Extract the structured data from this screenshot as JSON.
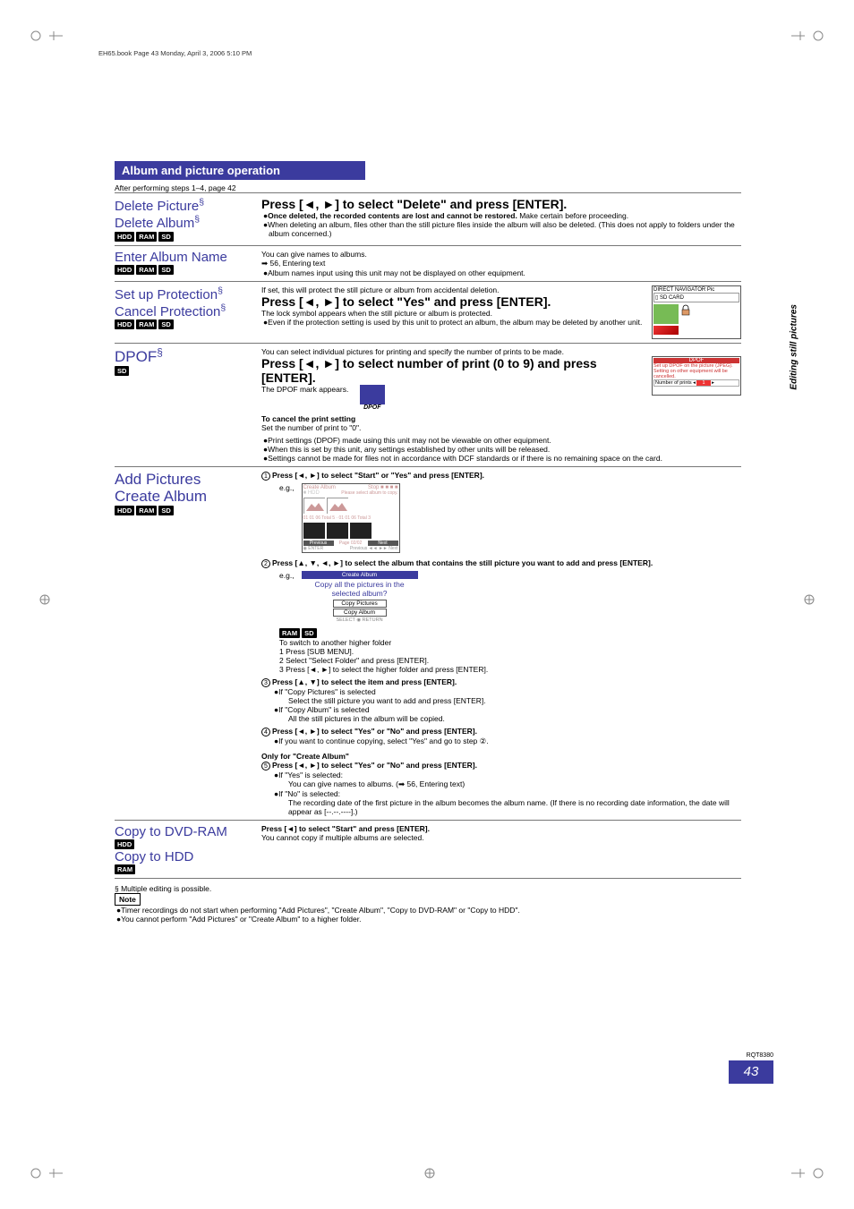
{
  "meta": {
    "header": "EH65.book  Page 43  Monday, April 3, 2006  5:10 PM"
  },
  "section": {
    "title": "Album and picture operation"
  },
  "intro": "After performing steps 1–4, page 42",
  "side": "Editing still pictures",
  "pagenum": "43",
  "rqt": "RQT8380",
  "badges": {
    "hdd": "HDD",
    "ram": "RAM",
    "sd": "SD"
  },
  "deletePic": {
    "t1": "Delete Picture",
    "t2": "Delete Album",
    "cmd": "Press [◄, ►] to select \"Delete\" and press [ENTER].",
    "b1a": "Once deleted, the recorded contents are lost and cannot be restored.",
    "b1b": " Make certain before proceeding.",
    "b2": "When deleting an album, files other than the still picture files inside the album will also be deleted. (This does not apply to folders under the album concerned.)"
  },
  "enter": {
    "t": "Enter Album Name",
    "l1": "You can give names to albums.",
    "l2": "➡ 56, Entering text",
    "l3": "Album names input using this unit may not be displayed on other equipment."
  },
  "protect": {
    "t1": "Set up Protection",
    "t2": "Cancel Protection",
    "l1": "If set, this will protect the still picture or album from accidental deletion.",
    "cmd": "Press [◄, ►] to select \"Yes\" and press [ENTER].",
    "l2": "The lock symbol appears when the still picture or album is protected.",
    "l3": "Even if the protection setting is used by this unit to protect an album, the album may be deleted by another unit.",
    "fig": {
      "h": "DIRECT NAVIGATOR     Pic",
      "sd": "▯ SD CARD"
    }
  },
  "dpof": {
    "t": "DPOF",
    "l1": "You can select individual pictures for printing and specify the number of prints to be made.",
    "cmd": "Press [◄, ►] to select number of print (0 to 9) and press [ENTER].",
    "fig": {
      "h": "DPOF",
      "s1": "Set up DPOF on the picture (JPEG).",
      "s2": "Setting on other equipment will be cancelled.",
      "s3": "Number of prints"
    },
    "l2": "The DPOF mark appears.",
    "dpoflbl": "DPOF",
    "cancelh": "To cancel the print setting",
    "cancelt": "Set the number of print to \"0\".",
    "b1": "Print settings (DPOF) made using this unit may not be viewable on other equipment.",
    "b2": "When this is set by this unit, any settings established by other units will be released.",
    "b3": "Settings cannot be made for files not in accordance with DCF standards or if there is no remaining space on the card."
  },
  "add": {
    "t1": "Add Pictures",
    "t2": "Create Album",
    "s1": "Press [◄, ►] to select \"Start\" or \"Yes\" and press [ENTER].",
    "eg": "e.g.,",
    "fig1": {
      "h": "Create Album",
      "stop": "Stop",
      "hint": "Please select album to copy.",
      "hdd": "■ HDD",
      "prev": "Previous",
      "page": "Page 02/02",
      "next": "Next",
      "foot": "Previous ◄◄ ►► Next"
    },
    "s2": "Press [▲, ▼, ◄, ►] to select the album that contains the still picture you want to add and press [ENTER].",
    "fig2": {
      "h": "Create Album",
      "q": "Copy all the pictures in the selected album?",
      "b1": "Copy Pictures",
      "b2": "Copy Album",
      "foot": "SELECT ◉ RETURN"
    },
    "switchh": "To switch to another higher folder",
    "sw1": "1  Press [SUB MENU].",
    "sw2": "2  Select \"Select Folder\" and press [ENTER].",
    "sw3": "3  Press [◄, ►] to select the higher folder and press [ENTER].",
    "s3": "Press [▲, ▼] to select the item and press [ENTER].",
    "if1": "If \"Copy Pictures\" is selected",
    "if1t": "Select the still picture you want to add and press [ENTER].",
    "if2": "If \"Copy Album\" is selected",
    "if2t": "All the still pictures in the album will be copied.",
    "s4": "Press [◄, ►] to select \"Yes\" or \"No\" and press [ENTER].",
    "s4b": "If you want to continue copying, select \"Yes\" and go to step ②.",
    "only": "Only for \"Create Album\"",
    "s5": "Press [◄, ►] to select \"Yes\" or \"No\" and press [ENTER].",
    "s5a": "If \"Yes\" is selected:",
    "s5at": "You can give names to albums. (➡ 56, Entering text)",
    "s5b": "If \"No\" is selected:",
    "s5bt": "The recording date of the first picture in the album becomes the album name. (If there is no recording date information, the date will appear as [--.--.----].)"
  },
  "copy": {
    "t1": "Copy to DVD-RAM",
    "t2": "Copy to HDD",
    "l1": "Press [◄] to select \"Start\" and press [ENTER].",
    "l2": "You cannot copy if multiple albums are selected."
  },
  "footer": {
    "mult": "§ Multiple editing is possible.",
    "note": "Note",
    "b1": "Timer recordings do not start when performing \"Add Pictures\", \"Create Album\", \"Copy to DVD-RAM\" or \"Copy to HDD\".",
    "b2": "You cannot perform \"Add Pictures\" or \"Create Album\" to a higher folder."
  }
}
